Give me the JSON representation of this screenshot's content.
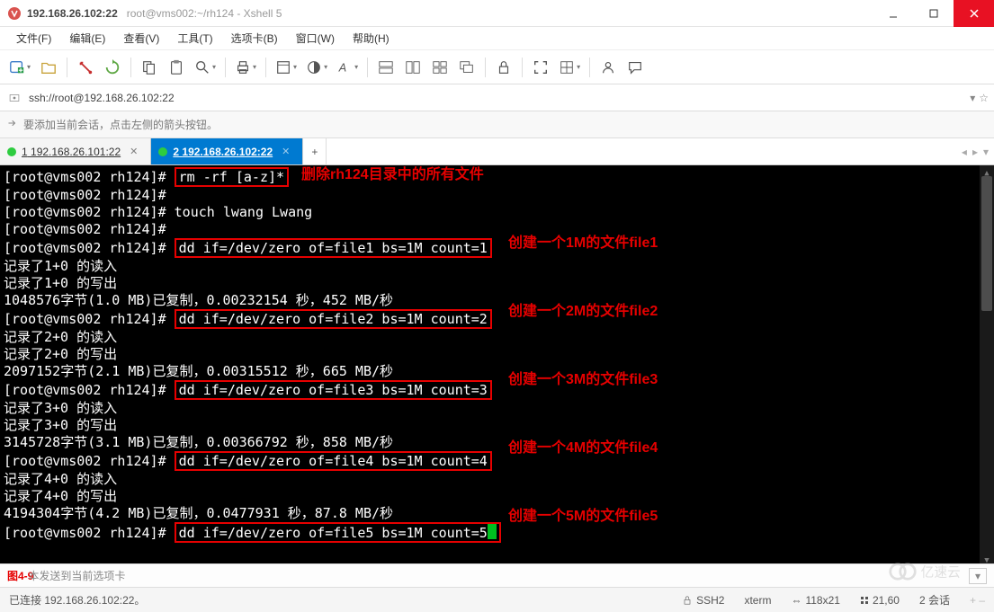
{
  "window": {
    "title_strong": "192.168.26.102:22",
    "title_sub": "root@vms002:~/rh124 - Xshell 5"
  },
  "menu": {
    "file": "文件(F)",
    "edit": "编辑(E)",
    "view": "查看(V)",
    "tools": "工具(T)",
    "tabs": "选项卡(B)",
    "window": "窗口(W)",
    "help": "帮助(H)"
  },
  "address": {
    "url": "ssh://root@192.168.26.102:22"
  },
  "hint": {
    "text": "要添加当前会话，点击左侧的箭头按钮。"
  },
  "sessions": {
    "tab1": {
      "index": "1",
      "label": "192.168.26.101:22"
    },
    "tab2": {
      "index": "2",
      "label": "192.168.26.102:22"
    },
    "add": "+"
  },
  "terminal": {
    "prompt": "[root@vms002 rh124]# ",
    "cmd_rm": "rm -rf [a-z]*",
    "cmd_touch": "touch lwang Lwang",
    "cmd_dd1": "dd if=/dev/zero of=file1 bs=1M count=1",
    "cmd_dd2": "dd if=/dev/zero of=file2 bs=1M count=2",
    "cmd_dd3": "dd if=/dev/zero of=file3 bs=1M count=3",
    "cmd_dd4": "dd if=/dev/zero of=file4 bs=1M count=4",
    "cmd_dd5": "dd if=/dev/zero of=file5 bs=1M count=5",
    "rec1_in": "记录了1+0 的读入",
    "rec1_out": "记录了1+0 的写出",
    "stat1": "1048576字节(1.0 MB)已复制，0.00232154 秒，452 MB/秒",
    "rec2_in": "记录了2+0 的读入",
    "rec2_out": "记录了2+0 的写出",
    "stat2": "2097152字节(2.1 MB)已复制，0.00315512 秒，665 MB/秒",
    "rec3_in": "记录了3+0 的读入",
    "rec3_out": "记录了3+0 的写出",
    "stat3": "3145728字节(3.1 MB)已复制，0.00366792 秒，858 MB/秒",
    "rec4_in": "记录了4+0 的读入",
    "rec4_out": "记录了4+0 的写出",
    "stat4": "4194304字节(4.2 MB)已复制，0.0477931 秒，87.8 MB/秒"
  },
  "annotations": {
    "a_rm": "删除rh124目录中的所有文件",
    "a_dd1": "创建一个1M的文件file1",
    "a_dd2": "创建一个2M的文件file2",
    "a_dd3": "创建一个3M的文件file3",
    "a_dd4": "创建一个4M的文件file4",
    "a_dd5": "创建一个5M的文件file5"
  },
  "sendbar": {
    "figure_label": "图4-9",
    "placeholder_rest": "本发送到当前选项卡"
  },
  "status": {
    "conn": "已连接 192.168.26.102:22。",
    "proto": "SSH2",
    "term": "xterm",
    "size": "118x21",
    "pos": "21,60",
    "sess": "2 会话"
  },
  "brand": {
    "name": "亿速云"
  }
}
